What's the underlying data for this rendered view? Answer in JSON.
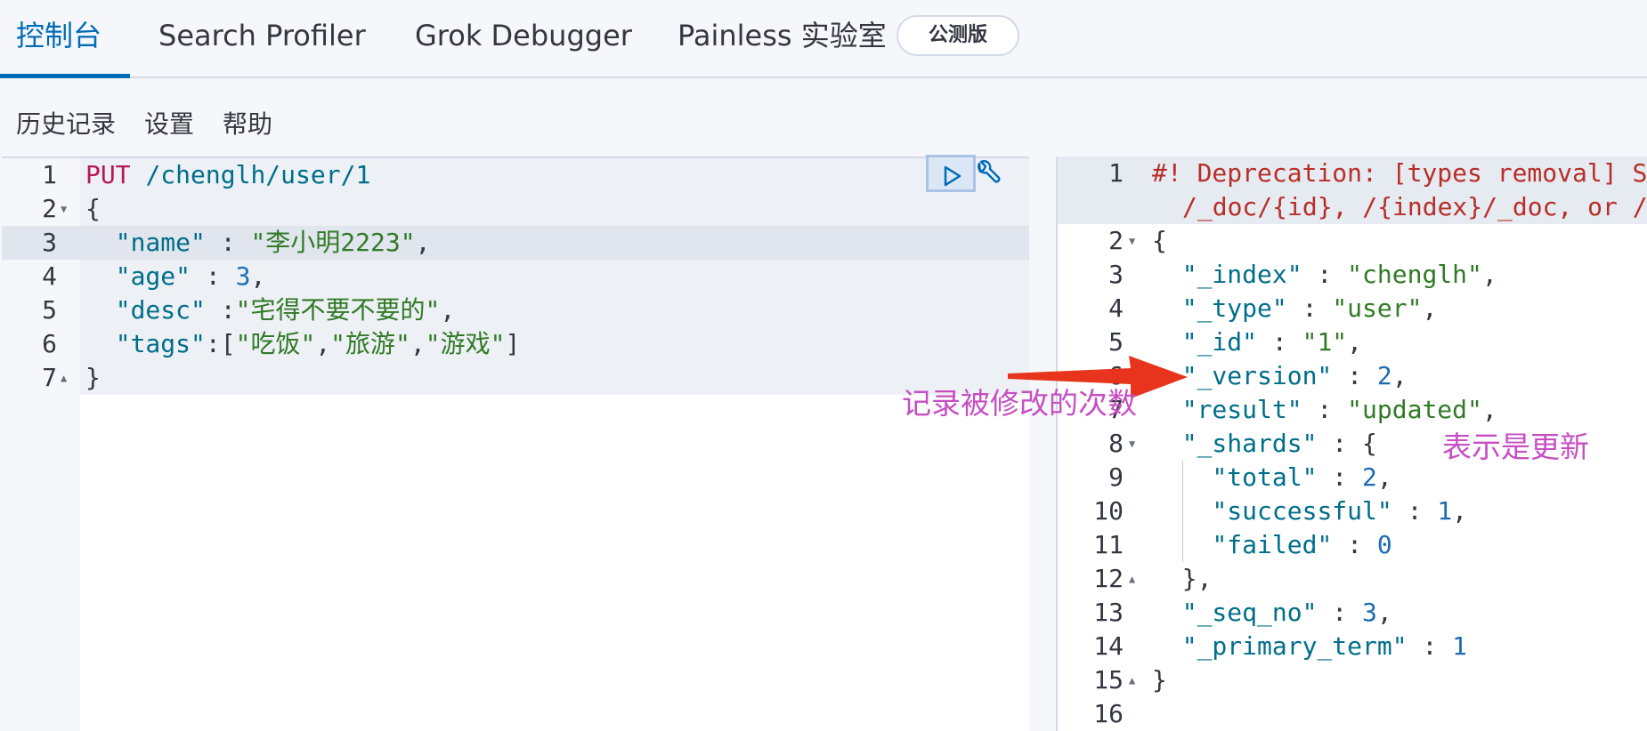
{
  "tabs": [
    {
      "label": "控制台"
    },
    {
      "label": "Search Profiler"
    },
    {
      "label": "Grok Debugger"
    },
    {
      "label": "Painless 实验室"
    }
  ],
  "beta_badge": "公测版",
  "menu": {
    "history": "历史记录",
    "settings": "设置",
    "help": "帮助"
  },
  "request": {
    "line_numbers": [
      "1",
      "2",
      "3",
      "4",
      "5",
      "6",
      "7"
    ],
    "method": "PUT",
    "path": "/chenglh/user/1",
    "brace_open": "{",
    "brace_close": "}",
    "fields": {
      "name_key": "\"name\"",
      "name_val": "\"李小明2223\"",
      "age_key": "\"age\"",
      "age_val": "3",
      "desc_key": "\"desc\"",
      "desc_val": "\"宅得不要不要的\"",
      "tags_key": "\"tags\"",
      "tag1": "\"吃饭\"",
      "tag2": "\"旅游\"",
      "tag3": "\"游戏\""
    }
  },
  "response": {
    "line_numbers": [
      "1",
      "2",
      "3",
      "4",
      "5",
      "6",
      "7",
      "8",
      "9",
      "10",
      "11",
      "12",
      "13",
      "14",
      "15",
      "16"
    ],
    "warning_line1": "#! Deprecation: [types removal] Sp",
    "warning_line2": "/_doc/{id}, /{index}/_doc, or /{",
    "index_key": "\"_index\"",
    "index_val": "\"chenglh\"",
    "type_key": "\"_type\"",
    "type_val": "\"user\"",
    "id_key": "\"_id\"",
    "id_val": "\"1\"",
    "version_key": "\"_version\"",
    "version_val": "2",
    "result_key": "\"result\"",
    "result_val": "\"updated\"",
    "shards_key": "\"_shards\"",
    "total_key": "\"total\"",
    "total_val": "2",
    "successful_key": "\"successful\"",
    "successful_val": "1",
    "failed_key": "\"failed\"",
    "failed_val": "0",
    "seq_key": "\"_seq_no\"",
    "seq_val": "3",
    "primary_key": "\"_primary_term\"",
    "primary_val": "1"
  },
  "annotations": {
    "version_note": "记录被修改的次数",
    "result_note": "表示是更新"
  },
  "colors": {
    "accent": "#006bb8",
    "annotation": "#c64fc3",
    "arrow": "#e8341c",
    "warning": "#b92d27",
    "string": "#317a26",
    "number": "#1d6cb3"
  },
  "icons": [
    "play-icon",
    "wrench-icon",
    "arrow-icon"
  ]
}
